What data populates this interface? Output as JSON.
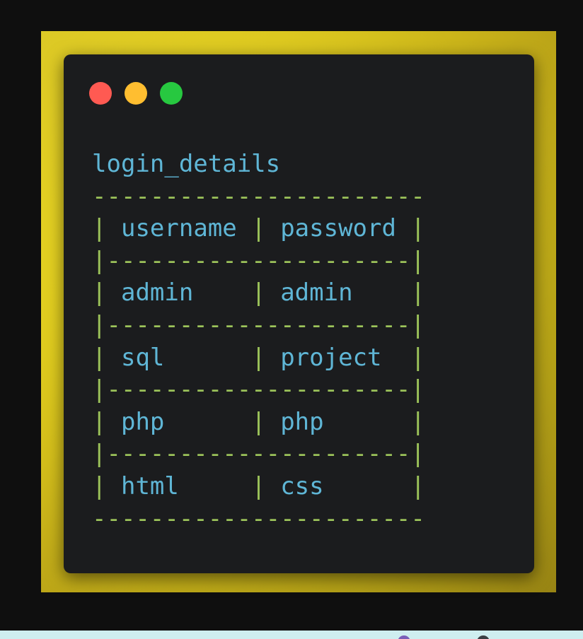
{
  "window_buttons": {
    "close_color": "#ff5a52",
    "minimize_color": "#ffbe30",
    "maximize_color": "#27c840"
  },
  "code": {
    "table_name": "login_details",
    "border_rule": "-----------------------",
    "separator": "|---------------------|",
    "pipe": "|",
    "columns": [
      "username",
      "password"
    ],
    "rows": [
      [
        "admin",
        "admin"
      ],
      [
        "sql",
        "project"
      ],
      [
        "php",
        "php"
      ],
      [
        "html",
        "css"
      ]
    ]
  },
  "colors": {
    "frame_yellow": "#e6d21d",
    "window_bg": "#1b1c1e",
    "text_blue": "#5fb6d6",
    "border_green": "#9cc35a",
    "page_bg": "#0f0f0f"
  }
}
